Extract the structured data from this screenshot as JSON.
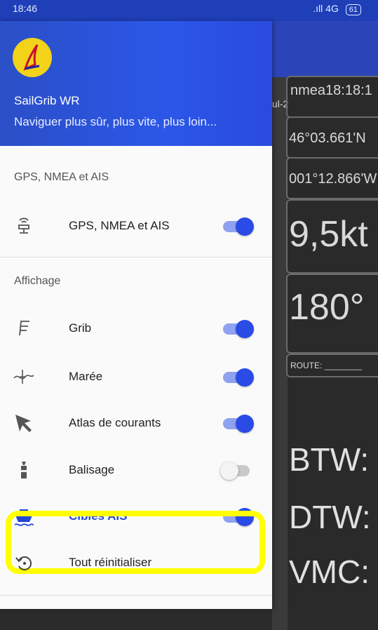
{
  "status_bar": {
    "time": "18:46",
    "signal": "4G",
    "battery": "61"
  },
  "drawer": {
    "app_name": "SailGrib WR",
    "tagline": "Naviguer plus sûr, plus vite, plus loin...",
    "sections": [
      {
        "title": "GPS, NMEA et AIS",
        "items": [
          {
            "label": "GPS, NMEA et AIS",
            "icon": "gps-antenna-icon",
            "enabled": true
          }
        ]
      },
      {
        "title": "Affichage",
        "items": [
          {
            "label": "Grib",
            "icon": "grib-icon",
            "enabled": true
          },
          {
            "label": "Marée",
            "icon": "tide-icon",
            "enabled": true
          },
          {
            "label": "Atlas de courants",
            "icon": "current-arrow-icon",
            "enabled": true
          },
          {
            "label": "Balisage",
            "icon": "buoy-icon",
            "enabled": false
          },
          {
            "label": "Cibles AIS",
            "icon": "ship-icon",
            "enabled": true,
            "highlighted": true
          },
          {
            "label": "Tout réinitialiser",
            "icon": "reset-icon"
          }
        ]
      }
    ]
  },
  "background_panel": {
    "nmea": "nmea18:18:1",
    "left_fragment": "ul-2",
    "lat": "46°03.661'N",
    "lon": "001°12.866'W",
    "speed": "9,5kt",
    "heading": "180°",
    "route": "ROUTE: ________",
    "btw": "BTW:",
    "dtw": "DTW:",
    "vmc": "VMC:"
  },
  "colors": {
    "primary": "#2a4be6",
    "header": "#2b4fc6",
    "highlight": "#ffff00",
    "active_label": "#2345d8"
  }
}
